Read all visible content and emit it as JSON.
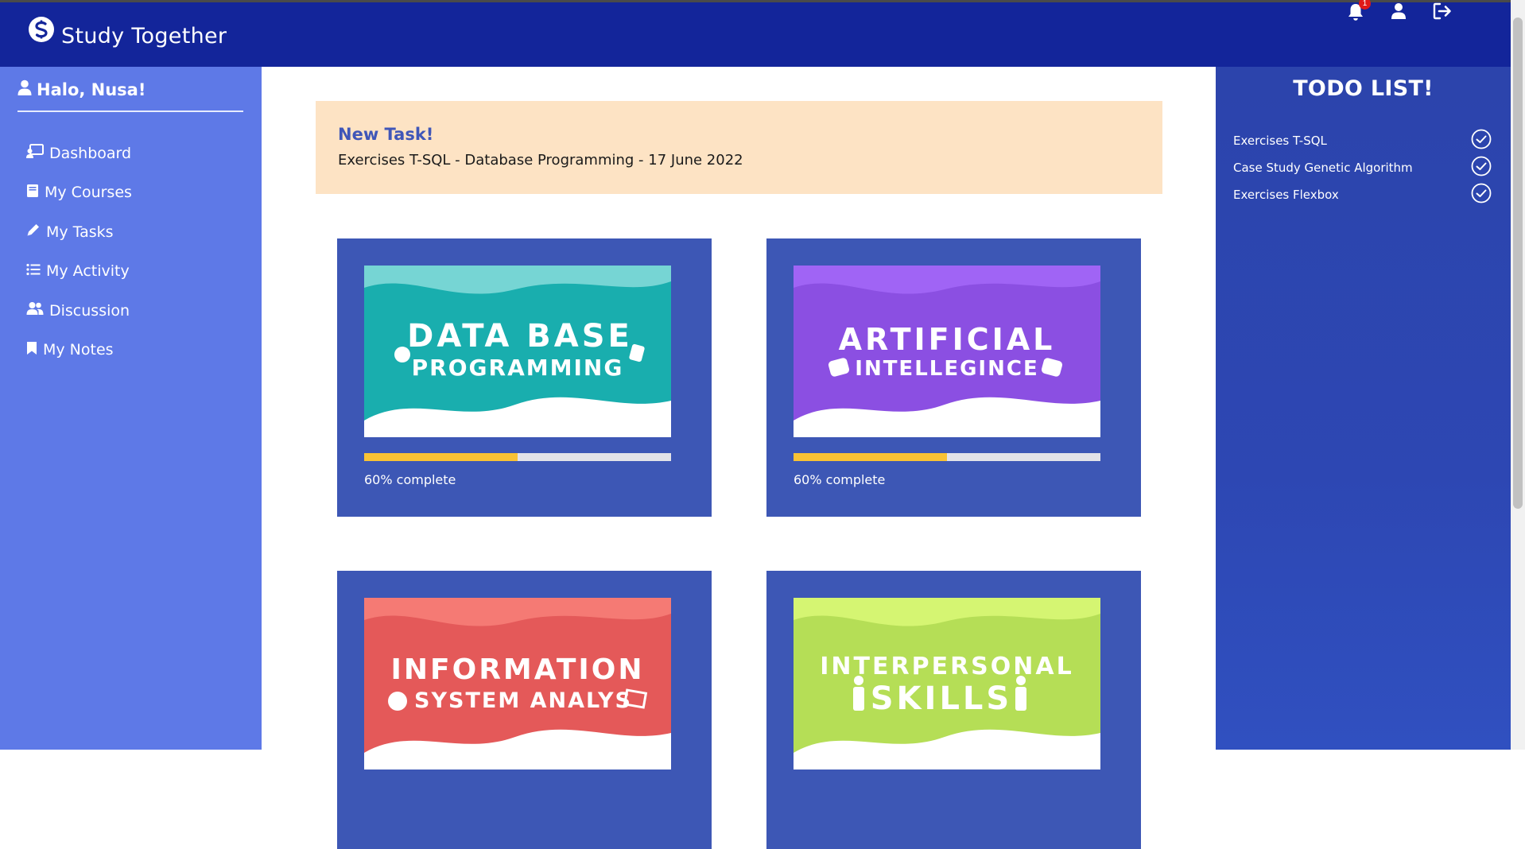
{
  "app": {
    "name": "Study Together",
    "notification_count": "1"
  },
  "sidebar": {
    "greeting": "Halo, Nusa!",
    "items": [
      {
        "label": "Dashboard",
        "icon": "dashboard-icon"
      },
      {
        "label": "My Courses",
        "icon": "book-icon"
      },
      {
        "label": "My Tasks",
        "icon": "pencil-icon"
      },
      {
        "label": "My Activity",
        "icon": "list-icon"
      },
      {
        "label": "Discussion",
        "icon": "users-icon"
      },
      {
        "label": "My Notes",
        "icon": "bookmark-icon"
      }
    ]
  },
  "alert": {
    "title": "New Task!",
    "text": "Exercises T-SQL - Database Programming - 17 June 2022"
  },
  "courses": [
    {
      "line1": "DATA BASE",
      "line2": "PROGRAMMING",
      "progress": 0.5,
      "progress_label": "60% complete",
      "top_color": "#76d5d4",
      "wave_color": "#19aeae"
    },
    {
      "line1": "ARTIFICIAL",
      "line2": "INTELLEGINCE",
      "progress": 0.5,
      "progress_label": "60% complete",
      "top_color": "#a064f5",
      "wave_color": "#8b4fe2"
    },
    {
      "line1": "INFORMATION",
      "line2": "SYSTEM ANALYS",
      "top_color": "#f57a74",
      "wave_color": "#e45959"
    },
    {
      "line1": "INTERPERSONAL",
      "line2": "SKILLS",
      "top_color": "#d5f572",
      "wave_color": "#b5de56"
    }
  ],
  "todo": {
    "title": "TODO LIST!",
    "items": [
      "Exercises T-SQL",
      "Case Study Genetic Algorithm",
      "Exercises Flexbox"
    ]
  },
  "colors": {
    "topbar": "#13259a",
    "sidebar": "#5e79e7",
    "card": "#3d57b5",
    "alert_bg": "#fde3c4",
    "progress": "#f9c235"
  }
}
